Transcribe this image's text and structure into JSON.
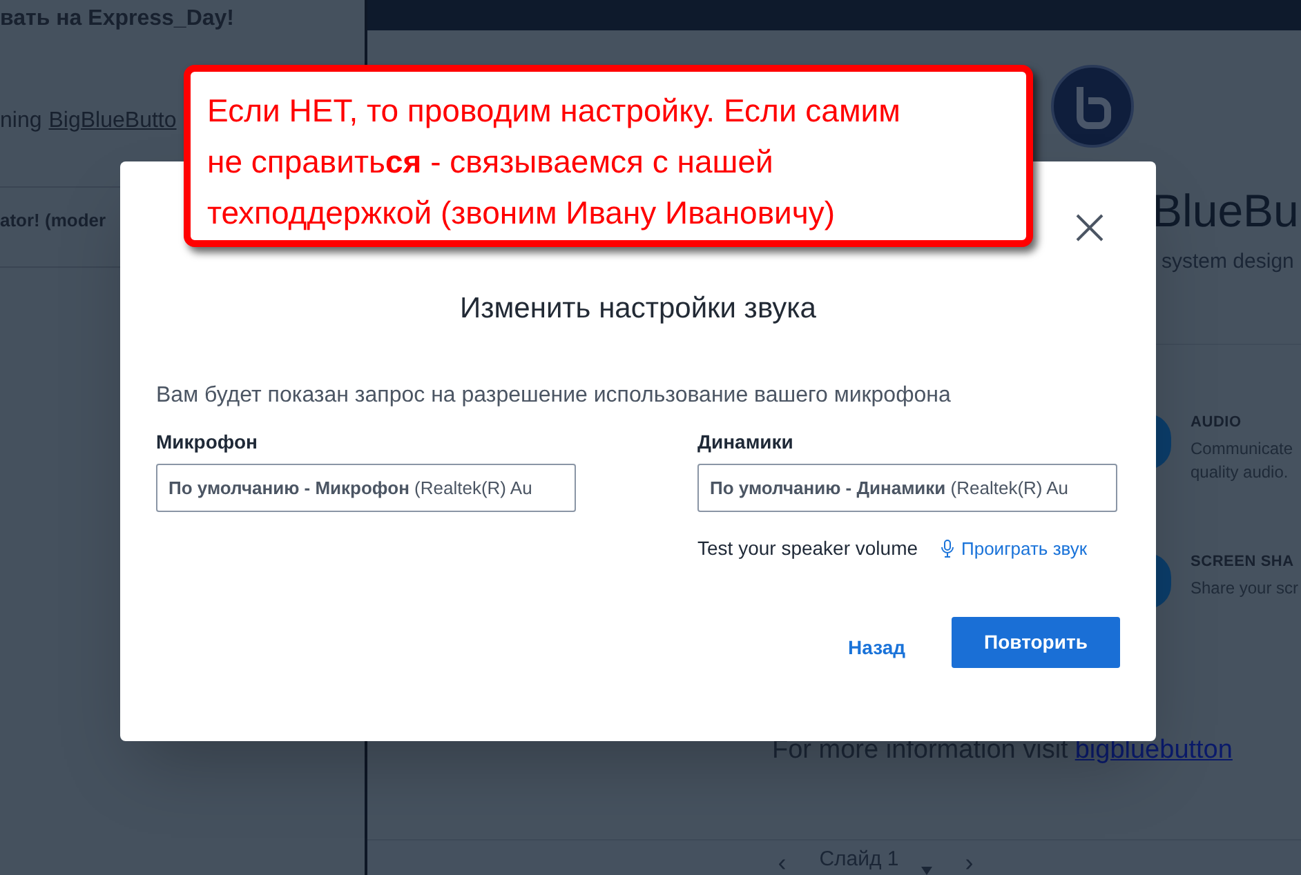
{
  "chat": {
    "lines": [
      {
        "kind": "text",
        "text": "вать на Express_Day!"
      },
      {
        "kind": "link",
        "text": "ning",
        "link": "BigBlueButto"
      },
      {
        "kind": "text",
        "text": "ator! (moder"
      }
    ]
  },
  "welcome": {
    "title": "BlueBu",
    "subtitle": "system design",
    "features": [
      {
        "title": "AUDIO",
        "lines": [
          "Communicate",
          "quality audio."
        ]
      },
      {
        "title": "SCREEN SHA",
        "lines": [
          "Share your scr"
        ]
      }
    ],
    "footer": {
      "text": "For more information visit",
      "link": "bigbluebutton"
    },
    "slide_nav": {
      "prev": "‹",
      "label": "Слайд 1",
      "next": "›"
    }
  },
  "modal": {
    "title": "Изменить настройки звука",
    "description": "Вам будет показан запрос на разрешение использование вашего микрофона",
    "fields": [
      {
        "label": "Микрофон",
        "value": "**По умолчанию - Микрофон** (Realtek(R) Au"
      },
      {
        "label": "Динамики",
        "value": "**По умолчанию - Динамики** (Realtek(R) Au"
      }
    ],
    "test_label": "Test your speaker volume",
    "play_link": "Проиграть звук",
    "buttons": [
      {
        "kind": "link",
        "label": "Назад"
      },
      {
        "kind": "primary",
        "label": "Повторить"
      }
    ]
  },
  "callout": {
    "text": "Если НЕТ, то проводим настройку. Если самим не справить**ся** - связываемся с нашей техподдержкой (звоним Ивану Ивановичу)"
  }
}
